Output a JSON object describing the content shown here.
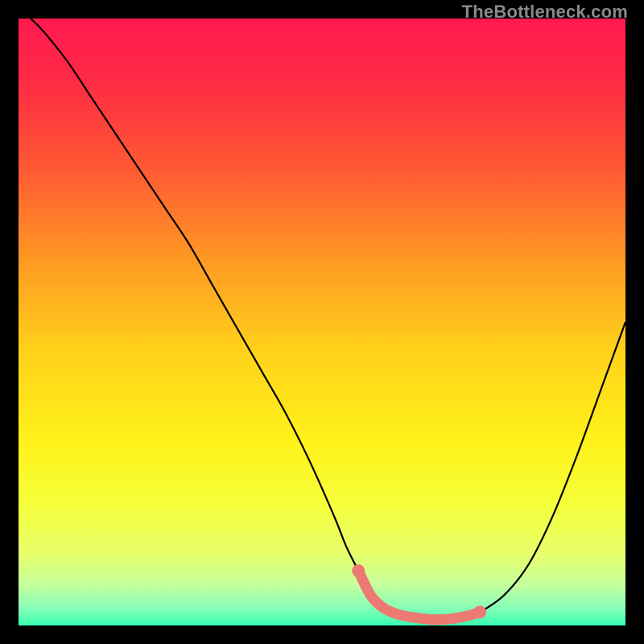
{
  "watermark": "TheBottleneck.com",
  "gradient": {
    "stops": [
      {
        "offset": 0.0,
        "color": "#ff1a4f"
      },
      {
        "offset": 0.1,
        "color": "#ff2a45"
      },
      {
        "offset": 0.25,
        "color": "#ff5a33"
      },
      {
        "offset": 0.4,
        "color": "#ff9a22"
      },
      {
        "offset": 0.55,
        "color": "#ffd21a"
      },
      {
        "offset": 0.7,
        "color": "#fff21a"
      },
      {
        "offset": 0.8,
        "color": "#f5ff3a"
      },
      {
        "offset": 0.88,
        "color": "#e8ff6a"
      },
      {
        "offset": 0.93,
        "color": "#c8ff9a"
      },
      {
        "offset": 0.97,
        "color": "#8affb8"
      },
      {
        "offset": 1.0,
        "color": "#34ffb0"
      }
    ]
  },
  "chart_data": {
    "type": "line",
    "title": "",
    "xlabel": "",
    "ylabel": "",
    "xlim": [
      0,
      100
    ],
    "ylim": [
      0,
      100
    ],
    "series": [
      {
        "name": "bottleneck-curve",
        "x": [
          2,
          4,
          8,
          12,
          16,
          20,
          24,
          28,
          32,
          36,
          40,
          44,
          48,
          52,
          54,
          56,
          58,
          60,
          62,
          64,
          66,
          68,
          70,
          72,
          74,
          76,
          80,
          84,
          88,
          92,
          96,
          100
        ],
        "y": [
          100,
          98,
          93,
          87,
          81,
          75,
          69,
          63,
          56,
          49,
          42,
          35,
          27,
          18,
          13,
          9,
          5,
          3,
          2,
          1.5,
          1.2,
          1,
          1,
          1.2,
          1.6,
          2.2,
          5,
          10,
          18,
          28,
          39,
          50
        ]
      }
    ],
    "highlight": {
      "name": "optimal-range",
      "color": "#ed7a72",
      "x": [
        56,
        58,
        60,
        62,
        64,
        66,
        68,
        70,
        72,
        74,
        76
      ],
      "y": [
        9,
        5,
        3,
        2,
        1.5,
        1.2,
        1,
        1,
        1.2,
        1.6,
        2.2
      ]
    }
  }
}
